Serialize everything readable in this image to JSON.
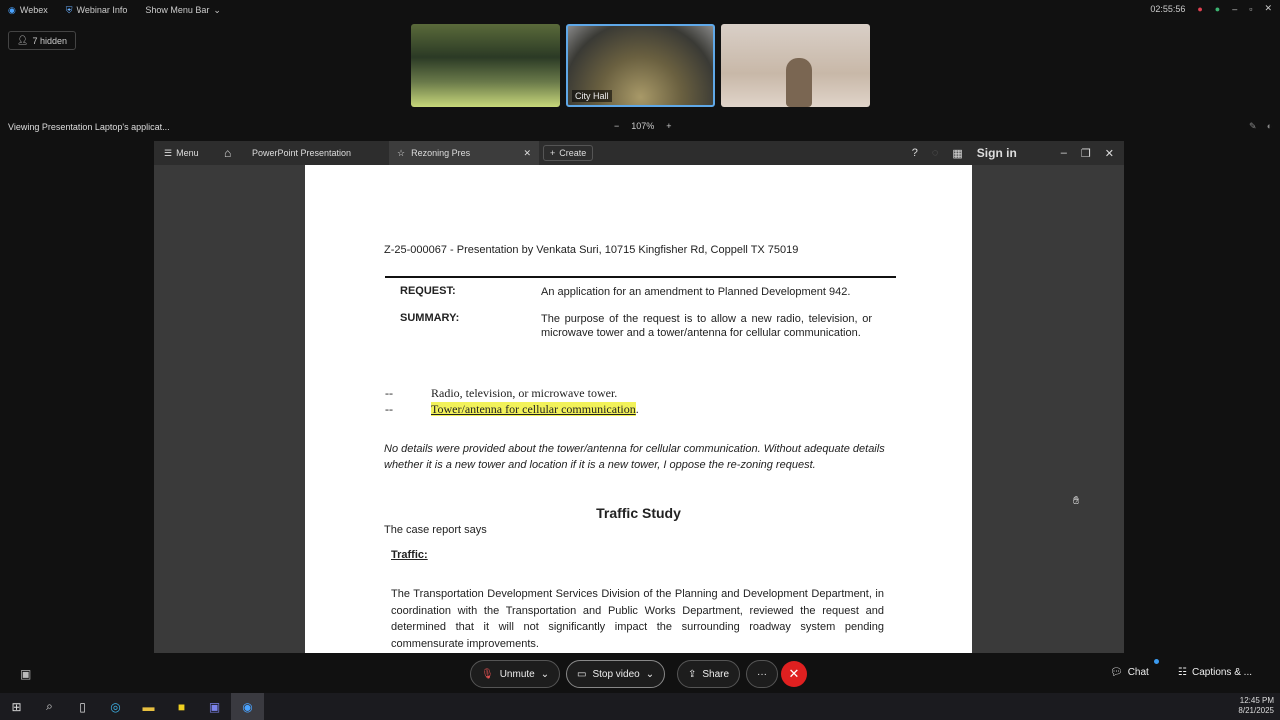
{
  "topbar": {
    "app_name": "Webex",
    "webinar_info": "Webinar Info",
    "show_menu_bar": "Show Menu Bar",
    "timer": "02:55:56"
  },
  "hidden_count": "7 hidden",
  "thumbnails": [
    {
      "label": ""
    },
    {
      "label": "City Hall"
    },
    {
      "label": ""
    }
  ],
  "viewing_text": "Viewing Presentation Laptop's applicat...",
  "zoom": {
    "minus": "−",
    "level": "107%",
    "plus": "+"
  },
  "appbar": {
    "menu": "Menu",
    "tab_ppt": "PowerPoint Presentation",
    "tab_active": "Rezoning Pres",
    "create": "Create",
    "sign_in": "Sign in"
  },
  "doc": {
    "header": "Z-25-000067 - Presentation by Venkata Suri, 10715 Kingfisher Rd, Coppell TX 75019",
    "request_label": "REQUEST:",
    "request_value": "An application for an amendment to Planned Development 942.",
    "summary_label": "SUMMARY:",
    "summary_value": "The purpose of the request is to allow a new radio, television, or microwave tower and a tower/antenna for cellular communication.",
    "bullet1_mark": "--",
    "bullet1": "Radio, television, or microwave tower.",
    "bullet2_mark": "--",
    "bullet2": "Tower/antenna for cellular communication",
    "bullet2_end": ".",
    "italic_para": "No details were provided about the tower/antenna for cellular communication. Without adequate details whether it is a new tower and location if it is a new tower, I oppose the re-zoning request.",
    "traffic_study": "Traffic Study",
    "case_says": "The case report says",
    "traffic_label": "Traffic:",
    "traffic_para": "The Transportation Development Services Division of the Planning and Development Department, in coordination with the Transportation and Public Works Department, reviewed the request and determined that it will not significantly impact the surrounding roadway system pending commensurate improvements."
  },
  "controls": {
    "unmute": "Unmute",
    "stop_video": "Stop video",
    "share": "Share",
    "more": "···",
    "chat": "Chat",
    "captions": "Captions & ..."
  },
  "clock": {
    "time": "12:45 PM",
    "date": "8/21/2025"
  }
}
